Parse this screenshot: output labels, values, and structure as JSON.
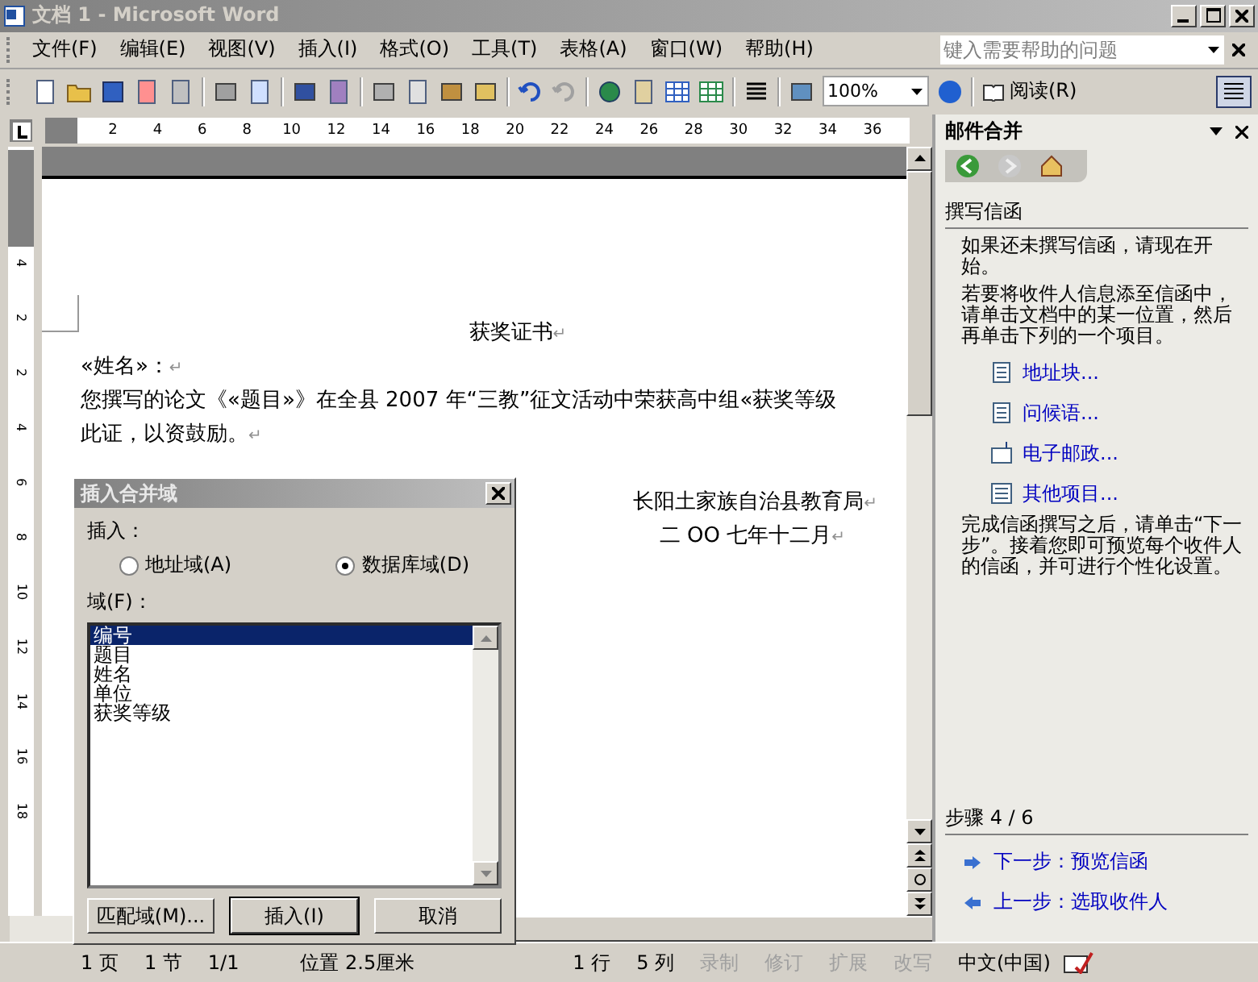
{
  "window": {
    "title": "文档 1 - Microsoft Word"
  },
  "menu": [
    "文件(F)",
    "编辑(E)",
    "视图(V)",
    "插入(I)",
    "格式(O)",
    "工具(T)",
    "表格(A)",
    "窗口(W)",
    "帮助(H)"
  ],
  "help_search": {
    "placeholder": "键入需要帮助的问题"
  },
  "toolbar": {
    "zoom": "100%",
    "read_button": "阅读(R)"
  },
  "ruler": {
    "marks": [
      "2",
      "4",
      "6",
      "8",
      "10",
      "12",
      "14",
      "16",
      "18",
      "20",
      "22",
      "24",
      "26",
      "28",
      "30",
      "32",
      "34",
      "36"
    ],
    "vertical_marks": [
      "4",
      "2",
      "2",
      "4",
      "6",
      "8",
      "10",
      "12",
      "14",
      "16",
      "18"
    ]
  },
  "document": {
    "paragraphs": [
      {
        "text": "获奖证书",
        "kind": "heading",
        "mark": "↵"
      },
      {
        "text": "«姓名»：",
        "kind": "body",
        "mark": "↵"
      },
      {
        "text": "您撰写的论文《«题目»》在全县 2007 年“三教”征文活动中荣获高中组«获奖等级",
        "kind": "body"
      },
      {
        "text": "此证，以资鼓励。",
        "kind": "body",
        "mark": "↵"
      },
      {
        "text": "长阳土家族自治县教育局",
        "kind": "signature",
        "mark": "↵"
      },
      {
        "text": "二 OO 七年十二月",
        "kind": "date",
        "mark": "↵"
      }
    ]
  },
  "dialog": {
    "title": "插入合并域",
    "insert_label": "插入：",
    "options": [
      {
        "label": "地址域(A)",
        "selected": false
      },
      {
        "label": "数据库域(D)",
        "selected": true
      }
    ],
    "fields_label": "域(F)：",
    "fields": [
      {
        "label": "编号",
        "selected": true
      },
      {
        "label": "题目",
        "selected": false
      },
      {
        "label": "姓名",
        "selected": false
      },
      {
        "label": "单位",
        "selected": false
      },
      {
        "label": "获奖等级",
        "selected": false
      }
    ],
    "buttons": [
      "匹配域(M)...",
      "插入(I)",
      "取消"
    ]
  },
  "task_pane": {
    "title": "邮件合并",
    "section": "撰写信函",
    "intro": "如果还未撰写信函，请现在开始。",
    "instruction": "若要将收件人信息添至信函中，请单击文档中的某一位置，然后再单击下列的一个项目。",
    "links": [
      {
        "label": "地址块...",
        "kind": "doc"
      },
      {
        "label": "问候语...",
        "kind": "doc"
      },
      {
        "label": "电子邮政...",
        "kind": "envelope"
      },
      {
        "label": "其他项目...",
        "kind": "list"
      }
    ],
    "after": "完成信函撰写之后，请单击“下一步”。接着您即可预览每个收件人的信函，并可进行个性化设置。",
    "step": "步骤 4 / 6",
    "next": "下一步：预览信函",
    "prev": "上一步：选取收件人"
  },
  "status_bar": [
    {
      "text": "1 页",
      "disabled": false
    },
    {
      "text": "1 节",
      "disabled": false
    },
    {
      "text": "1/1",
      "disabled": false
    },
    {
      "text": "位置 2.5厘米",
      "disabled": false
    },
    {
      "text": "1 行",
      "disabled": false
    },
    {
      "text": "5 列",
      "disabled": false
    },
    {
      "text": "录制",
      "disabled": true
    },
    {
      "text": "修订",
      "disabled": true
    },
    {
      "text": "扩展",
      "disabled": true
    },
    {
      "text": "改写",
      "disabled": true
    },
    {
      "text": "中文(中国)",
      "disabled": false
    }
  ]
}
